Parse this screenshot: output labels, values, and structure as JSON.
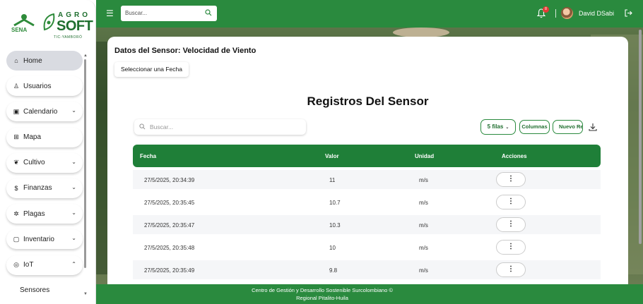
{
  "sidebar": {
    "logo": {
      "sena": "SENA",
      "agro": "AGRO",
      "soft": "SOFT",
      "tagline": "TIC-YAMBORÓ"
    },
    "items": [
      {
        "label": "Home",
        "icon": "home-icon",
        "glyph": "⌂"
      },
      {
        "label": "Usuarios",
        "icon": "user-icon",
        "glyph": "♙"
      },
      {
        "label": "Calendario",
        "icon": "calendar-icon",
        "glyph": "▣"
      },
      {
        "label": "Mapa",
        "icon": "map-icon",
        "glyph": "⊞"
      },
      {
        "label": "Cultivo",
        "icon": "leaf-icon",
        "glyph": "❦"
      },
      {
        "label": "Finanzas",
        "icon": "dollar-icon",
        "glyph": "$"
      },
      {
        "label": "Plagas",
        "icon": "bug-icon",
        "glyph": "✲"
      },
      {
        "label": "Inventario",
        "icon": "clipboard-icon",
        "glyph": "▢"
      },
      {
        "label": "IoT",
        "icon": "iot-icon",
        "glyph": "◎"
      }
    ],
    "subitem": "Sensores"
  },
  "topbar": {
    "search_placeholder": "Buscar...",
    "notifications": "8",
    "username": "David DSabi"
  },
  "card": {
    "title": "Datos del Sensor: Velocidad de Viento",
    "date_button": "Seleccionar una Fecha",
    "table_title": "Registros Del Sensor",
    "search_placeholder": "Buscar...",
    "rows_select": "5 filas",
    "columns_button": "Columnas",
    "new_button": "Nuevo Re",
    "headers": {
      "fecha": "Fecha",
      "valor": "Valor",
      "unidad": "Unidad",
      "acciones": "Acciones"
    },
    "rows": [
      {
        "fecha": "27/5/2025, 20:34:39",
        "valor": "11",
        "unidad": "m/s",
        "accion": "⋮"
      },
      {
        "fecha": "27/5/2025, 20:35:45",
        "valor": "10.7",
        "unidad": "m/s",
        "accion": "⋮"
      },
      {
        "fecha": "27/5/2025, 20:35:47",
        "valor": "10.3",
        "unidad": "m/s",
        "accion": "⋮"
      },
      {
        "fecha": "27/5/2025, 20:35:48",
        "valor": "10",
        "unidad": "m/s",
        "accion": "⋮"
      },
      {
        "fecha": "27/5/2025, 20:35:49",
        "valor": "9.8",
        "unidad": "m/s",
        "accion": "⋮"
      }
    ]
  },
  "footer": {
    "line1": "Centro de Gestión y Desarrollo Sostenible Surcolombiano ©",
    "line2": "Regional Pitalito-Huila"
  },
  "colors": {
    "primary": "#2a8a3e",
    "table_header": "#1f7f38"
  }
}
